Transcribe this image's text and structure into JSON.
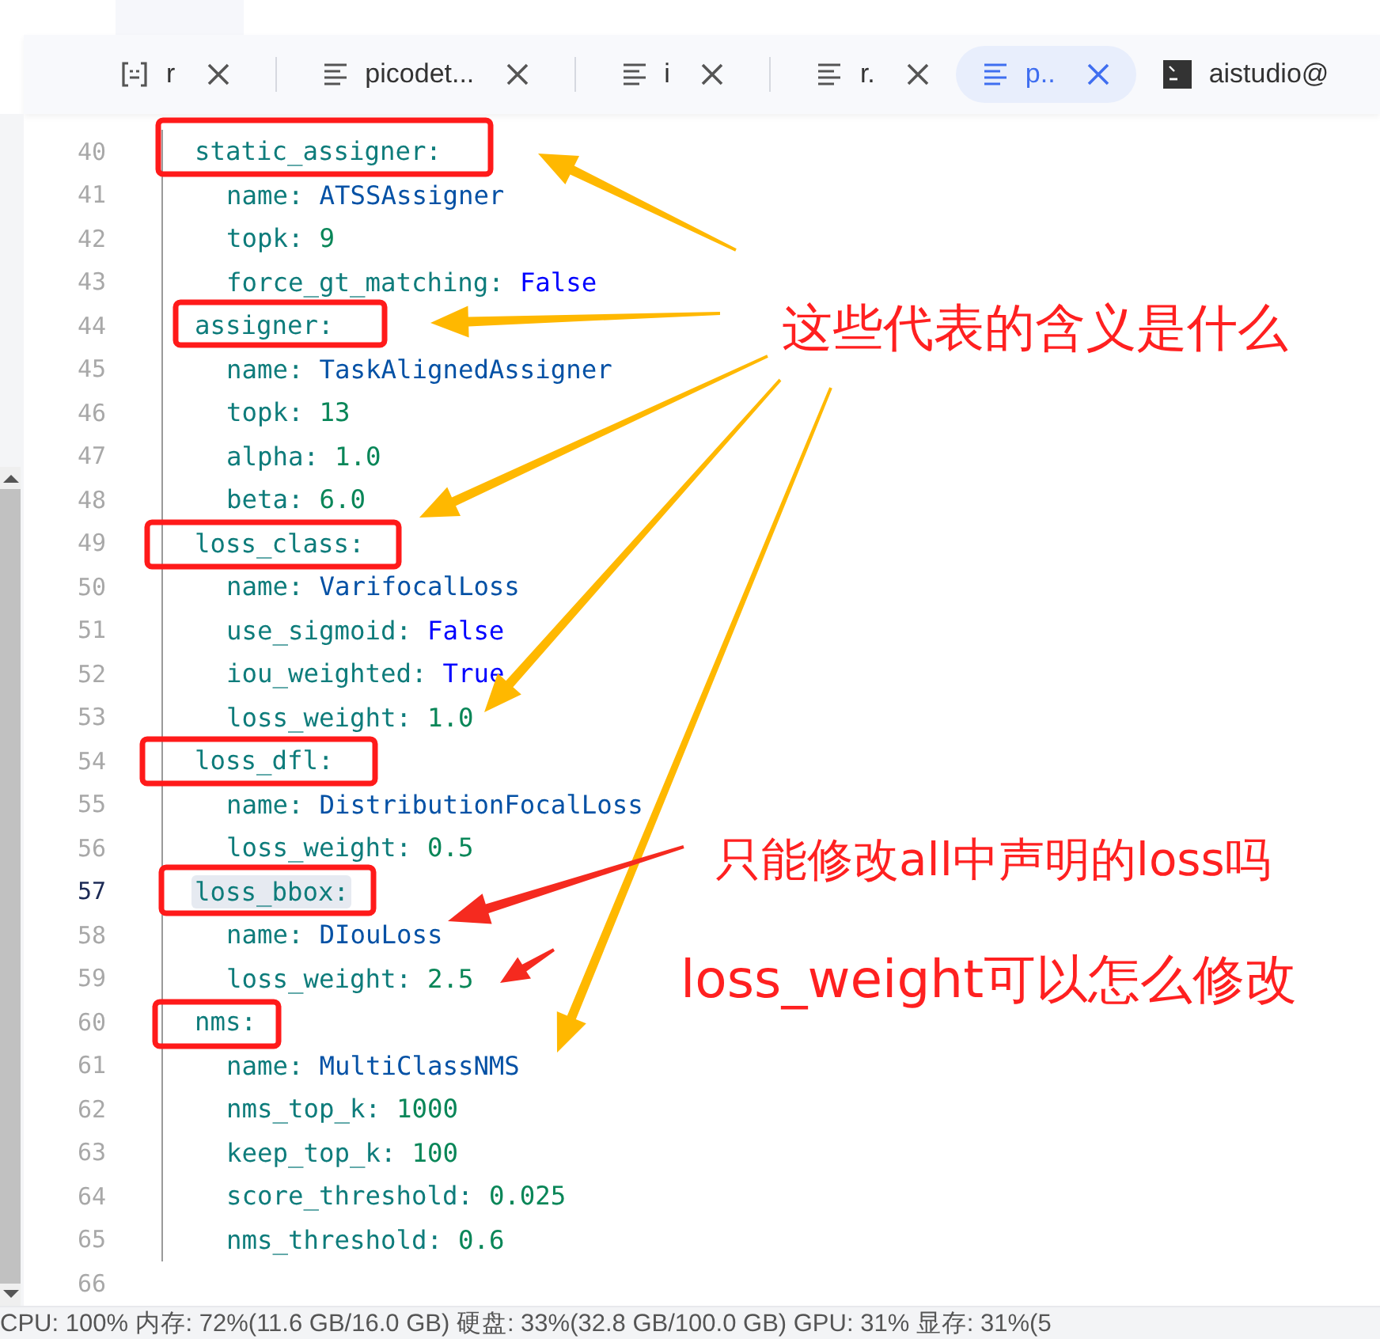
{
  "tabs": [
    {
      "kind": "bracket",
      "label": "r",
      "selected": false,
      "closable": true
    },
    {
      "kind": "doc",
      "label": "picodet...",
      "selected": false,
      "closable": true
    },
    {
      "kind": "doc",
      "label": "i",
      "selected": false,
      "closable": true
    },
    {
      "kind": "doc",
      "label": "r.",
      "selected": false,
      "closable": true
    },
    {
      "kind": "doc",
      "label": "p..",
      "selected": true,
      "closable": true
    },
    {
      "kind": "terminal",
      "label": "aistudio@",
      "selected": false,
      "closable": false
    }
  ],
  "editor": {
    "blocks": [
      {
        "line": "40",
        "key": "static_assigner:",
        "current": false,
        "children": [
          {
            "line": "41",
            "key": "name:",
            "value": "ATSSAssigner",
            "kind": "string",
            "current": false
          },
          {
            "line": "42",
            "key": "topk:",
            "value": "9",
            "kind": "number",
            "current": false
          },
          {
            "line": "43",
            "key": "force_gt_matching:",
            "value": "False",
            "kind": "boolean",
            "current": false
          }
        ]
      },
      {
        "line": "44",
        "key": "assigner:",
        "current": false,
        "children": [
          {
            "line": "45",
            "key": "name:",
            "value": "TaskAlignedAssigner",
            "kind": "string",
            "current": false
          },
          {
            "line": "46",
            "key": "topk:",
            "value": "13",
            "kind": "number",
            "current": false
          },
          {
            "line": "47",
            "key": "alpha:",
            "value": "1.0",
            "kind": "number",
            "current": false
          },
          {
            "line": "48",
            "key": "beta:",
            "value": "6.0",
            "kind": "number",
            "current": false
          }
        ]
      },
      {
        "line": "49",
        "key": "loss_class:",
        "current": false,
        "children": [
          {
            "line": "50",
            "key": "name:",
            "value": "VarifocalLoss",
            "kind": "string",
            "current": false
          },
          {
            "line": "51",
            "key": "use_sigmoid:",
            "value": "False",
            "kind": "boolean",
            "current": false
          },
          {
            "line": "52",
            "key": "iou_weighted:",
            "value": "True",
            "kind": "boolean",
            "current": false
          },
          {
            "line": "53",
            "key": "loss_weight:",
            "value": "1.0",
            "kind": "number",
            "current": false
          }
        ]
      },
      {
        "line": "54",
        "key": "loss_dfl:",
        "current": false,
        "children": [
          {
            "line": "55",
            "key": "name:",
            "value": "DistributionFocalLoss",
            "kind": "string",
            "current": false
          },
          {
            "line": "56",
            "key": "loss_weight:",
            "value": "0.5",
            "kind": "number",
            "current": false
          }
        ]
      },
      {
        "line": "57",
        "key": "loss_bbox:",
        "current": true,
        "children": [
          {
            "line": "58",
            "key": "name:",
            "value": "DIouLoss",
            "kind": "string",
            "current": false
          },
          {
            "line": "59",
            "key": "loss_weight:",
            "value": "2.5",
            "kind": "number",
            "current": false
          }
        ]
      },
      {
        "line": "60",
        "key": "nms:",
        "current": false,
        "children": [
          {
            "line": "61",
            "key": "name:",
            "value": "MultiClassNMS",
            "kind": "string",
            "current": false
          },
          {
            "line": "62",
            "key": "nms_top_k:",
            "value": "1000",
            "kind": "number",
            "current": false
          },
          {
            "line": "63",
            "key": "keep_top_k:",
            "value": "100",
            "kind": "number",
            "current": false
          },
          {
            "line": "64",
            "key": "score_threshold:",
            "value": "0.025",
            "kind": "number",
            "current": false
          },
          {
            "line": "65",
            "key": "nms_threshold:",
            "value": "0.6",
            "kind": "number",
            "current": false
          }
        ]
      }
    ],
    "end_line": "66"
  },
  "annotations": [
    {
      "text": "这些代表的含义是什么"
    },
    {
      "text": "只能修改all中声明的loss吗"
    },
    {
      "text": "loss_weight可以怎么修改"
    }
  ],
  "status_bar": "CPU: 100% 内存: 72%(11.6 GB/16.0 GB) 硬盘: 33%(32.8 GB/100.0 GB) GPU: 31% 显存: 31%(5"
}
